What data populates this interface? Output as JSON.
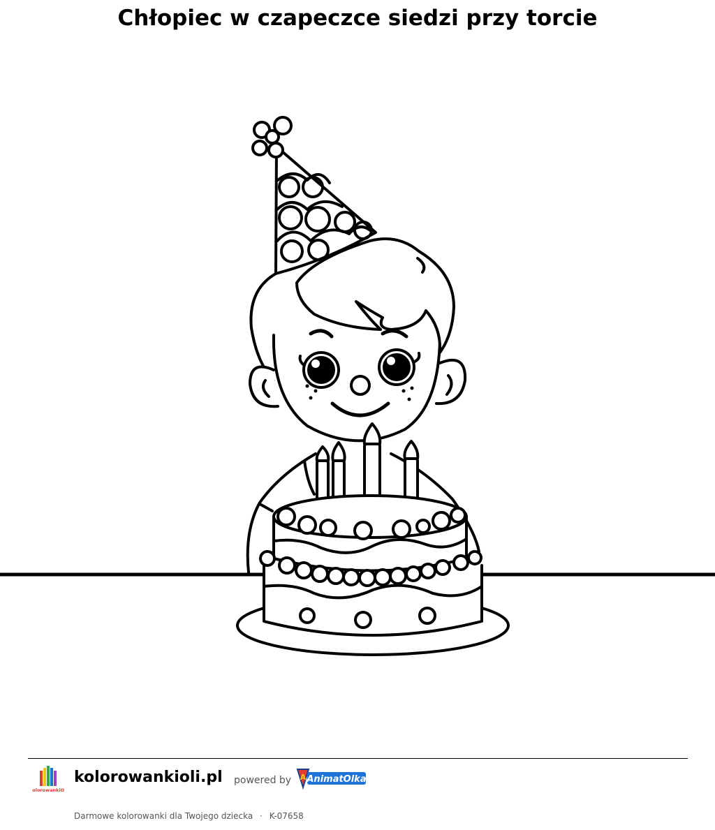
{
  "page": {
    "title": "Chłopiec w czapeczce siedzi przy torcie"
  },
  "footer": {
    "site_name": "kolorowankioli.pl",
    "powered_by": "powered by",
    "brand_logo_text": "AnimatOlka",
    "small_logo_text": "KolorowankiOli",
    "tagline": "Darmowe kolorowanki dla Twojego dziecka",
    "separator": "·",
    "code": "K-07658"
  },
  "icons": {
    "site_logo": "colorful-crayons-logo-icon",
    "brand_logo": "animatolka-superhero-badge-icon",
    "illustration": "boy-with-party-hat-and-birthday-cake"
  },
  "colors": {
    "line": "#000000",
    "background": "#ffffff",
    "brand_blue": "#1e73d8",
    "brand_red": "#e23b2e",
    "brand_yellow": "#f7c21b"
  }
}
